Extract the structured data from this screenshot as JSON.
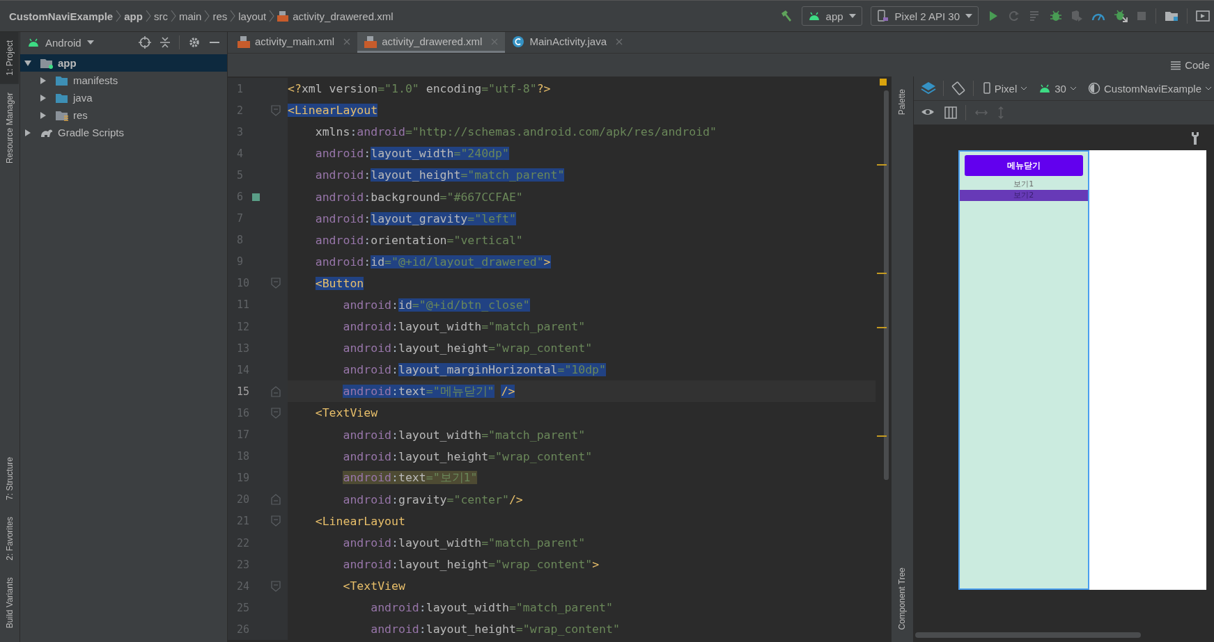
{
  "breadcrumb": [
    {
      "text": "CustomNaviExample",
      "kind": "project"
    },
    {
      "text": "app",
      "kind": "module"
    },
    {
      "text": "src",
      "kind": "folder"
    },
    {
      "text": "main",
      "kind": "folder"
    },
    {
      "text": "res",
      "kind": "folder"
    },
    {
      "text": "layout",
      "kind": "folder"
    },
    {
      "text": "activity_drawered.xml",
      "kind": "file"
    }
  ],
  "run_config": "app",
  "device": "Pixel 2 API 30",
  "left_tools_top": [
    {
      "label": "1: Project",
      "selected": true
    },
    {
      "label": "Resource Manager",
      "selected": false
    }
  ],
  "left_tools_bottom": [
    {
      "label": "7: Structure",
      "selected": false
    },
    {
      "label": "2: Favorites",
      "selected": false
    },
    {
      "label": "Build Variants",
      "selected": false
    }
  ],
  "project": {
    "view": "Android",
    "tree": [
      {
        "label": "app",
        "kind": "module",
        "expanded": true,
        "selected": true,
        "children": [
          {
            "label": "manifests",
            "kind": "folder",
            "expanded": false,
            "selected": false
          },
          {
            "label": "java",
            "kind": "folder",
            "expanded": false,
            "selected": false
          },
          {
            "label": "res",
            "kind": "res",
            "expanded": false,
            "selected": false
          }
        ]
      },
      {
        "label": "Gradle Scripts",
        "kind": "gradle",
        "expanded": false,
        "selected": false
      }
    ]
  },
  "tabs": [
    {
      "label": "activity_main.xml",
      "kind": "xml",
      "selected": false
    },
    {
      "label": "activity_drawered.xml",
      "kind": "xml",
      "selected": true
    },
    {
      "label": "MainActivity.java",
      "kind": "class",
      "selected": false
    }
  ],
  "view_mode": "Code",
  "editor": {
    "lines": [
      {
        "number": "1",
        "current": false,
        "tokens": [
          {
            "text": "<?",
            "kind": "tag"
          },
          {
            "text": "xml version",
            "kind": "attr"
          },
          {
            "text": "=\"1.0\"",
            "kind": "str"
          },
          {
            "text": " encoding",
            "kind": "attr"
          },
          {
            "text": "=\"utf-8\"",
            "kind": "str"
          },
          {
            "text": "?>",
            "kind": "tag"
          }
        ]
      },
      {
        "number": "2",
        "current": false,
        "fold_start": true,
        "tokens": [
          {
            "text": "<LinearLayout",
            "kind": "tag",
            "selected": true
          }
        ]
      },
      {
        "number": "3",
        "current": false,
        "tokens": [
          {
            "text": "    xmlns",
            "kind": "attr"
          },
          {
            "text": ":",
            "kind": "plain"
          },
          {
            "text": "android",
            "kind": "ns"
          },
          {
            "text": "=\"http://schemas.android.com/apk/res/android\"",
            "kind": "str"
          }
        ]
      },
      {
        "number": "4",
        "current": false,
        "tokens": [
          {
            "text": "    android",
            "kind": "ns"
          },
          {
            "text": ":",
            "kind": "plain"
          },
          {
            "text": "layout_width",
            "kind": "attr",
            "selected": true
          },
          {
            "text": "=\"240dp\"",
            "kind": "str",
            "selected": true
          }
        ]
      },
      {
        "number": "5",
        "current": false,
        "tokens": [
          {
            "text": "    android",
            "kind": "ns"
          },
          {
            "text": ":",
            "kind": "plain"
          },
          {
            "text": "layout_height",
            "kind": "attr",
            "selected": true
          },
          {
            "text": "=\"match_parent\"",
            "kind": "str",
            "selected": true
          }
        ]
      },
      {
        "number": "6",
        "current": false,
        "swatch": true,
        "tokens": [
          {
            "text": "    android",
            "kind": "ns"
          },
          {
            "text": ":",
            "kind": "plain"
          },
          {
            "text": "background",
            "kind": "attr"
          },
          {
            "text": "=\"#667CCFAE\"",
            "kind": "str"
          }
        ]
      },
      {
        "number": "7",
        "current": false,
        "tokens": [
          {
            "text": "    android",
            "kind": "ns"
          },
          {
            "text": ":",
            "kind": "plain"
          },
          {
            "text": "layout_gravity",
            "kind": "attr",
            "selected": true
          },
          {
            "text": "=\"left\"",
            "kind": "str",
            "selected": true
          }
        ]
      },
      {
        "number": "8",
        "current": false,
        "tokens": [
          {
            "text": "    android",
            "kind": "ns"
          },
          {
            "text": ":",
            "kind": "plain"
          },
          {
            "text": "orientation",
            "kind": "attr"
          },
          {
            "text": "=\"vertical\"",
            "kind": "str"
          }
        ]
      },
      {
        "number": "9",
        "current": false,
        "tokens": [
          {
            "text": "    android",
            "kind": "ns"
          },
          {
            "text": ":",
            "kind": "plain"
          },
          {
            "text": "id",
            "kind": "attr",
            "selected": true
          },
          {
            "text": "=\"@+id/layout_drawered\"",
            "kind": "str",
            "selected": true
          },
          {
            "text": ">",
            "kind": "tag",
            "selected": true
          }
        ]
      },
      {
        "number": "10",
        "current": false,
        "fold_start": true,
        "tokens": [
          {
            "text": "    <Button",
            "kind": "tag",
            "selected": true
          }
        ]
      },
      {
        "number": "11",
        "current": false,
        "tokens": [
          {
            "text": "        android",
            "kind": "ns"
          },
          {
            "text": ":",
            "kind": "plain"
          },
          {
            "text": "id",
            "kind": "attr",
            "selected": true
          },
          {
            "text": "=\"@+id/btn_close\"",
            "kind": "str",
            "selected": true
          }
        ]
      },
      {
        "number": "12",
        "current": false,
        "tokens": [
          {
            "text": "        android",
            "kind": "ns"
          },
          {
            "text": ":",
            "kind": "plain"
          },
          {
            "text": "layout_width",
            "kind": "attr"
          },
          {
            "text": "=\"match_parent\"",
            "kind": "str"
          }
        ]
      },
      {
        "number": "13",
        "current": false,
        "tokens": [
          {
            "text": "        android",
            "kind": "ns"
          },
          {
            "text": ":",
            "kind": "plain"
          },
          {
            "text": "layout_height",
            "kind": "attr"
          },
          {
            "text": "=\"wrap_content\"",
            "kind": "str"
          }
        ]
      },
      {
        "number": "14",
        "current": false,
        "tokens": [
          {
            "text": "        android",
            "kind": "ns"
          },
          {
            "text": ":",
            "kind": "plain"
          },
          {
            "text": "layout_marginHorizontal",
            "kind": "attr",
            "selected": true
          },
          {
            "text": "=\"10dp\"",
            "kind": "str",
            "selected": true
          }
        ]
      },
      {
        "number": "15",
        "current": true,
        "fold_end": true,
        "tokens": [
          {
            "text": "        android",
            "kind": "ns",
            "selected": true
          },
          {
            "text": ":",
            "kind": "plain",
            "selected": true
          },
          {
            "text": "text",
            "kind": "attr",
            "selected": true
          },
          {
            "text": "=\"메뉴닫기\"",
            "kind": "str",
            "selected": true
          },
          {
            "text": " />",
            "kind": "tag",
            "selected": true
          }
        ]
      },
      {
        "number": "16",
        "current": false,
        "fold_start": true,
        "tokens": [
          {
            "text": "    <TextView",
            "kind": "tag"
          }
        ]
      },
      {
        "number": "17",
        "current": false,
        "tokens": [
          {
            "text": "        android",
            "kind": "ns"
          },
          {
            "text": ":",
            "kind": "plain"
          },
          {
            "text": "layout_width",
            "kind": "attr"
          },
          {
            "text": "=\"match_parent\"",
            "kind": "str"
          }
        ]
      },
      {
        "number": "18",
        "current": false,
        "tokens": [
          {
            "text": "        android",
            "kind": "ns"
          },
          {
            "text": ":",
            "kind": "plain"
          },
          {
            "text": "layout_height",
            "kind": "attr"
          },
          {
            "text": "=\"wrap_content\"",
            "kind": "str"
          }
        ]
      },
      {
        "number": "19",
        "current": false,
        "tokens": [
          {
            "text": "        android",
            "kind": "ns",
            "matched": true
          },
          {
            "text": ":",
            "kind": "plain",
            "matched": true
          },
          {
            "text": "text",
            "kind": "attr",
            "matched": true
          },
          {
            "text": "=\"보기1\"",
            "kind": "str",
            "matched": true
          }
        ]
      },
      {
        "number": "20",
        "current": false,
        "fold_end": true,
        "tokens": [
          {
            "text": "        android",
            "kind": "ns"
          },
          {
            "text": ":",
            "kind": "plain"
          },
          {
            "text": "gravity",
            "kind": "attr"
          },
          {
            "text": "=\"center\"",
            "kind": "str"
          },
          {
            "text": "/>",
            "kind": "tag"
          }
        ]
      },
      {
        "number": "21",
        "current": false,
        "fold_start": true,
        "tokens": [
          {
            "text": "    <LinearLayout",
            "kind": "tag"
          }
        ]
      },
      {
        "number": "22",
        "current": false,
        "tokens": [
          {
            "text": "        android",
            "kind": "ns"
          },
          {
            "text": ":",
            "kind": "plain"
          },
          {
            "text": "layout_width",
            "kind": "attr"
          },
          {
            "text": "=\"match_parent\"",
            "kind": "str"
          }
        ]
      },
      {
        "number": "23",
        "current": false,
        "tokens": [
          {
            "text": "        android",
            "kind": "ns"
          },
          {
            "text": ":",
            "kind": "plain"
          },
          {
            "text": "layout_height",
            "kind": "attr"
          },
          {
            "text": "=\"wrap_content\"",
            "kind": "str"
          },
          {
            "text": ">",
            "kind": "tag"
          }
        ]
      },
      {
        "number": "24",
        "current": false,
        "fold_start": true,
        "tokens": [
          {
            "text": "        <TextView",
            "kind": "tag"
          }
        ]
      },
      {
        "number": "25",
        "current": false,
        "tokens": [
          {
            "text": "            android",
            "kind": "ns"
          },
          {
            "text": ":",
            "kind": "plain"
          },
          {
            "text": "layout_width",
            "kind": "attr"
          },
          {
            "text": "=\"match_parent\"",
            "kind": "str"
          }
        ]
      },
      {
        "number": "26",
        "current": false,
        "tokens": [
          {
            "text": "            android",
            "kind": "ns"
          },
          {
            "text": ":",
            "kind": "plain"
          },
          {
            "text": "layout_height",
            "kind": "attr"
          },
          {
            "text": "=\"wrap_content\"",
            "kind": "str"
          }
        ]
      }
    ]
  },
  "right_tools_top": [
    "Palette"
  ],
  "right_tools_bottom": [
    "Component Tree"
  ],
  "design": {
    "device": "Pixel",
    "api": "30",
    "theme": "CustomNaviExample",
    "preview": {
      "button": "메뉴닫기",
      "items": [
        {
          "text": "보기1",
          "highlighted": false
        },
        {
          "text": "보기2",
          "highlighted": true
        }
      ]
    }
  }
}
